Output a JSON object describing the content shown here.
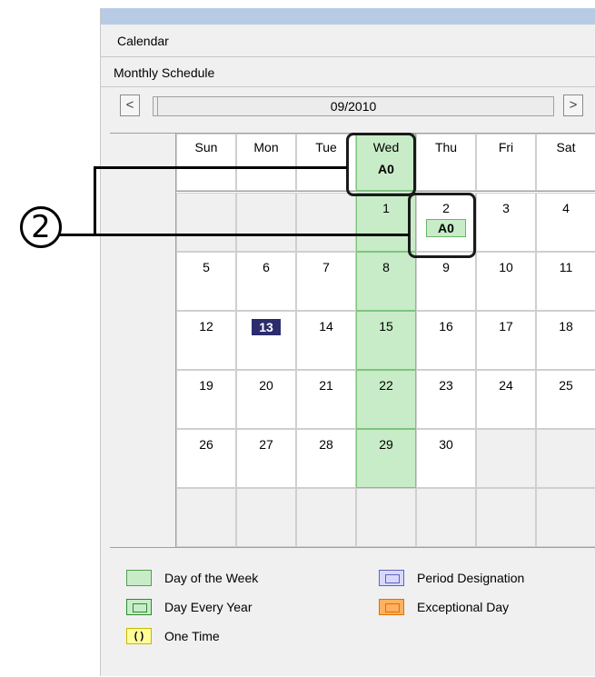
{
  "window": {
    "title": "Calendar",
    "subtitle": "Monthly Schedule"
  },
  "nav": {
    "prev": "<",
    "next": ">",
    "month": "09/2010"
  },
  "weekdays": [
    "Sun",
    "Mon",
    "Tue",
    "Wed",
    "Thu",
    "Fri",
    "Sat"
  ],
  "header_badge": "A0",
  "callout_number": "2",
  "weeks": [
    [
      "",
      "",
      "",
      "1",
      "2",
      "3",
      "4"
    ],
    [
      "5",
      "6",
      "7",
      "8",
      "9",
      "10",
      "11"
    ],
    [
      "12",
      "13",
      "14",
      "15",
      "16",
      "17",
      "18"
    ],
    [
      "19",
      "20",
      "21",
      "22",
      "23",
      "24",
      "25"
    ],
    [
      "26",
      "27",
      "28",
      "29",
      "30",
      "",
      ""
    ],
    [
      "",
      "",
      "",
      "",
      "",
      "",
      ""
    ]
  ],
  "today": "13",
  "day2_badge": "A0",
  "legend": {
    "day_of_week": "Day of the Week",
    "day_every_year": "Day Every Year",
    "one_time": "One Time",
    "one_time_swatch": "( )",
    "period_designation": "Period Designation",
    "exceptional_day": "Exceptional Day"
  },
  "colors": {
    "day_of_week": "#c8ecc8",
    "day_every_year": "#c8ecc8",
    "one_time": "#ffff99",
    "period_designation": "#d8d8ff",
    "exceptional_day": "#ffb060",
    "today_bg": "#2c2c6c",
    "titlebar": "#b8cbe4"
  }
}
